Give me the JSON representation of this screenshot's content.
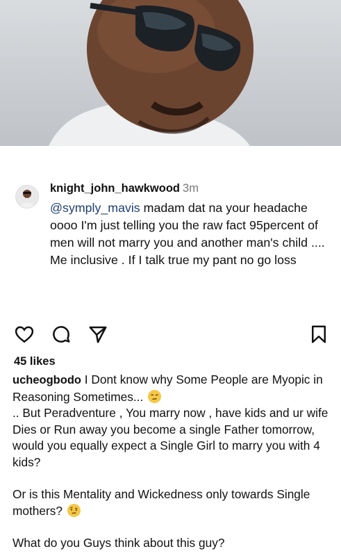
{
  "post": {
    "likes": "45 likes"
  },
  "comment": {
    "username": "knight_john_hawkwood",
    "time": "3m",
    "mention": "@symply_mavis",
    "text": " madam dat na your headache oooo I'm just telling you the raw fact 95percent of men will not marry you and another man's child .... Me inclusive . If I talk true my pant no go loss"
  },
  "caption": {
    "username": "ucheogbodo",
    "line1": " I Dont know why Some People are Myopic in Reasoning Sometimes... ",
    "para2": ".. But  Peradventure , You marry now , have kids and ur wife Dies or Run away  you become a single Father tomorrow, would you equally expect a Single Girl to marry you with 4 kids?",
    "para3": "Or is this Mentality and Wickedness only towards Single mothers? ",
    "para4": "What do you Guys think about this guy?"
  },
  "icons": {
    "like": "heart-icon",
    "comment": "comment-icon",
    "share": "send-icon",
    "save": "bookmark-icon"
  }
}
